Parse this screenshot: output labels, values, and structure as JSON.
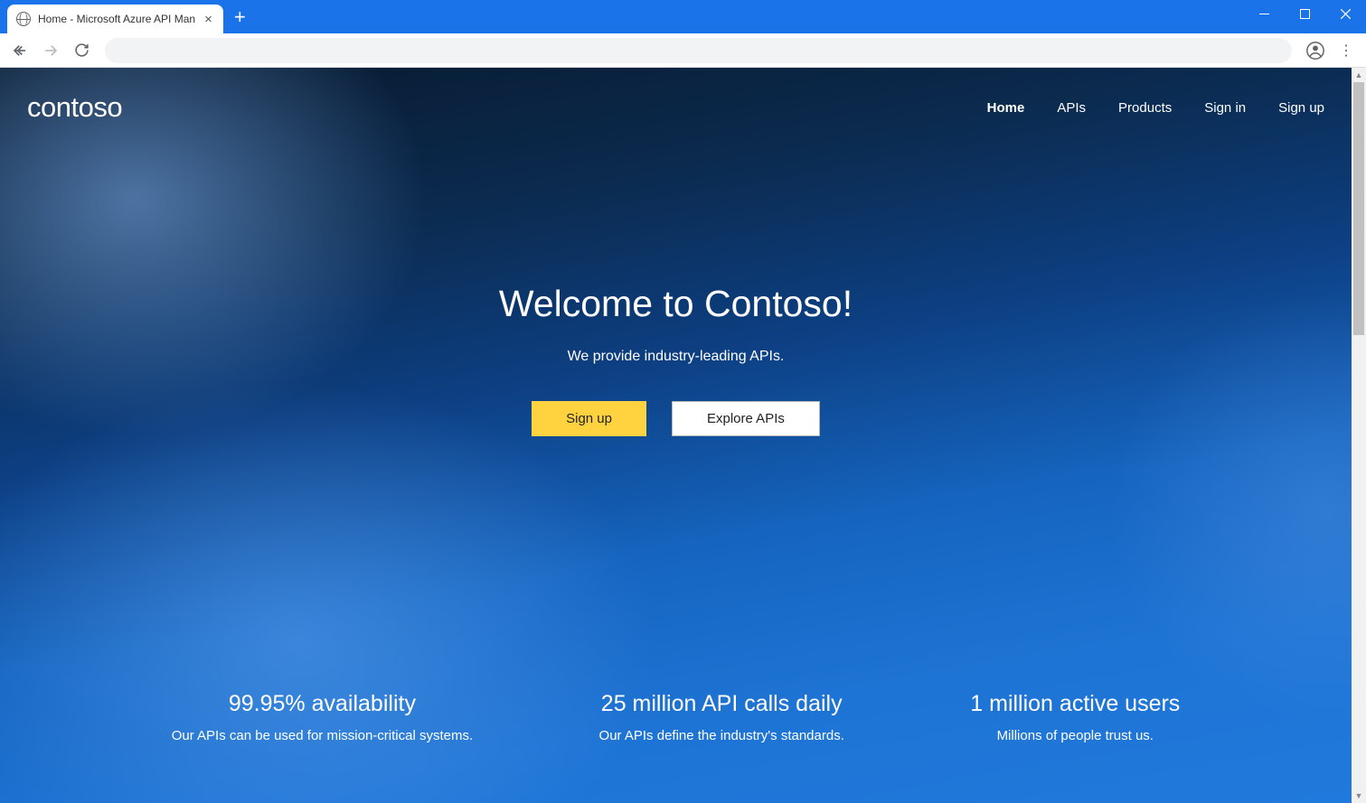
{
  "browser": {
    "tab_title": "Home - Microsoft Azure API Man"
  },
  "header": {
    "logo": "contoso",
    "nav": {
      "home": "Home",
      "apis": "APIs",
      "products": "Products",
      "signin": "Sign in",
      "signup": "Sign up"
    }
  },
  "hero": {
    "title": "Welcome to Contoso!",
    "subtitle": "We provide industry-leading APIs.",
    "btn_primary": "Sign up",
    "btn_secondary": "Explore APIs"
  },
  "stats": [
    {
      "title": "99.95% availability",
      "sub": "Our APIs can be used for mission-critical systems."
    },
    {
      "title": "25 million API calls daily",
      "sub": "Our APIs define the industry's standards."
    },
    {
      "title": "1 million active users",
      "sub": "Millions of people trust us."
    }
  ]
}
